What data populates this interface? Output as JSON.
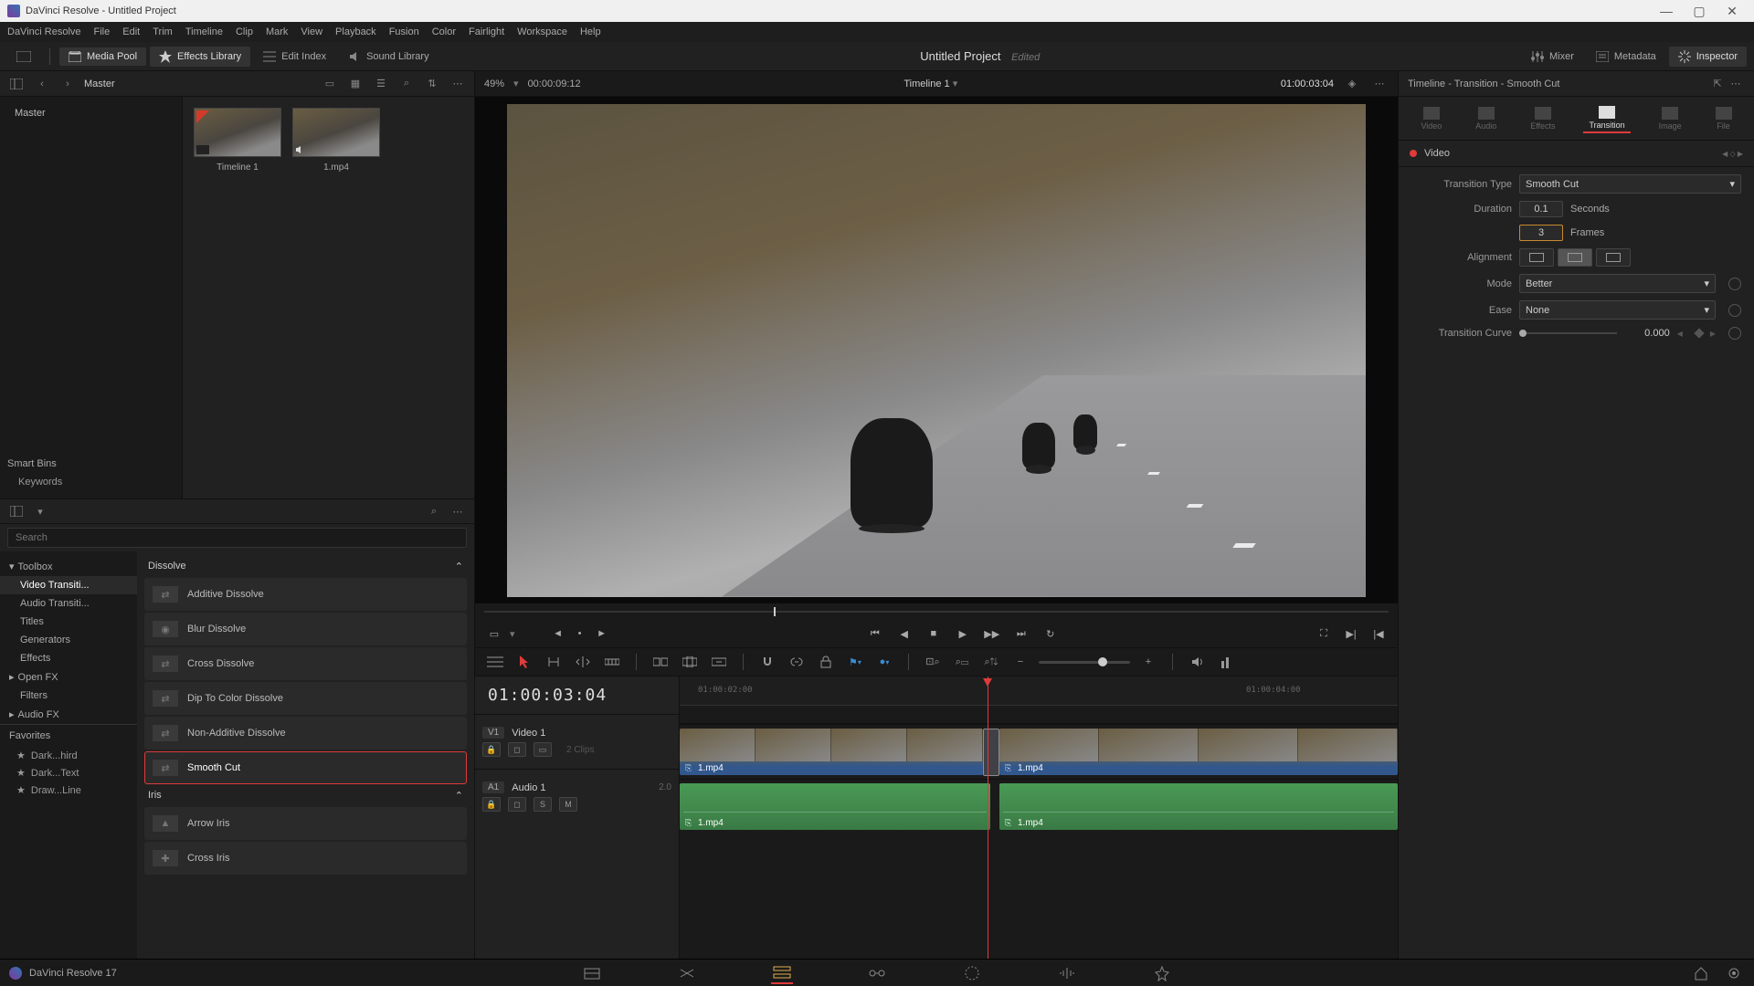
{
  "window": {
    "title": "DaVinci Resolve - Untitled Project"
  },
  "menu": [
    "DaVinci Resolve",
    "File",
    "Edit",
    "Trim",
    "Timeline",
    "Clip",
    "Mark",
    "View",
    "Playback",
    "Fusion",
    "Color",
    "Fairlight",
    "Workspace",
    "Help"
  ],
  "topToolbar": {
    "mediaPool": "Media Pool",
    "effectsLibrary": "Effects Library",
    "editIndex": "Edit Index",
    "soundLibrary": "Sound Library",
    "projectTitle": "Untitled Project",
    "edited": "Edited",
    "mixer": "Mixer",
    "metadata": "Metadata",
    "inspector": "Inspector"
  },
  "mediaPool": {
    "master": "Master",
    "binRoot": "Master",
    "smartBins": "Smart Bins",
    "keywords": "Keywords",
    "clips": [
      {
        "name": "Timeline 1",
        "type": "timeline"
      },
      {
        "name": "1.mp4",
        "type": "clip"
      }
    ]
  },
  "effects": {
    "searchPlaceholder": "Search",
    "tree": {
      "toolbox": "Toolbox",
      "videoTransitions": "Video Transiti...",
      "audioTransitions": "Audio Transiti...",
      "titles": "Titles",
      "generators": "Generators",
      "effects": "Effects",
      "openFx": "Open FX",
      "filters": "Filters",
      "audioFx": "Audio FX"
    },
    "groups": {
      "dissolve": "Dissolve",
      "iris": "Iris"
    },
    "dissolveItems": [
      "Additive Dissolve",
      "Blur Dissolve",
      "Cross Dissolve",
      "Dip To Color Dissolve",
      "Non-Additive Dissolve",
      "Smooth Cut"
    ],
    "irisItems": [
      "Arrow Iris",
      "Cross Iris"
    ],
    "favorites": "Favorites",
    "favItems": [
      "Dark...hird",
      "Dark...Text",
      "Draw...Line"
    ]
  },
  "viewer": {
    "zoom": "49%",
    "tcLeft": "00:00:09:12",
    "title": "Timeline 1",
    "tcRight": "01:00:03:04"
  },
  "timeline": {
    "tc": "01:00:03:04",
    "rulerLabels": [
      "01:00:02:00",
      "01:00:04:00"
    ],
    "v1": {
      "tag": "V1",
      "name": "Video 1",
      "clips": "2 Clips",
      "clip1": "1.mp4",
      "clip2": "1.mp4"
    },
    "a1": {
      "tag": "A1",
      "name": "Audio 1",
      "ch": "2.0",
      "clip1": "1.mp4",
      "clip2": "1.mp4"
    }
  },
  "inspector": {
    "header": "Timeline - Transition - Smooth Cut",
    "tabs": {
      "video": "Video",
      "audio": "Audio",
      "effects": "Effects",
      "transition": "Transition",
      "image": "Image",
      "file": "File"
    },
    "section": "Video",
    "transitionTypeLbl": "Transition Type",
    "transitionType": "Smooth Cut",
    "durationLbl": "Duration",
    "durationSec": "0.1",
    "durationSecUnit": "Seconds",
    "durationFrames": "3",
    "durationFramesUnit": "Frames",
    "alignmentLbl": "Alignment",
    "modeLbl": "Mode",
    "mode": "Better",
    "easeLbl": "Ease",
    "ease": "None",
    "curveLbl": "Transition Curve",
    "curveVal": "0.000"
  },
  "bottomNav": {
    "version": "DaVinci Resolve 17"
  }
}
